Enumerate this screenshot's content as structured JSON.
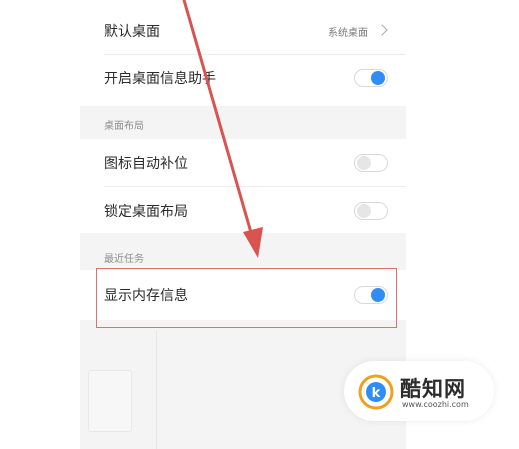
{
  "settings": {
    "rows": [
      {
        "label": "默认桌面",
        "value": "系统桌面"
      },
      {
        "label": "开启桌面信息助手",
        "state": "on"
      }
    ],
    "sections": [
      {
        "title": "桌面布局",
        "rows": [
          {
            "label": "图标自动补位",
            "state": "off"
          },
          {
            "label": "锁定桌面布局",
            "state": "off"
          }
        ]
      },
      {
        "title": "最近任务",
        "rows": [
          {
            "label": "显示内存信息",
            "state": "on"
          }
        ]
      }
    ]
  },
  "colors": {
    "toggle_on": "#2f8df5",
    "annotation_red": "#d9534f",
    "panel_background": "#f4f4f5"
  },
  "watermark": {
    "name": "酷知网",
    "url": "www.coozhi.com"
  }
}
